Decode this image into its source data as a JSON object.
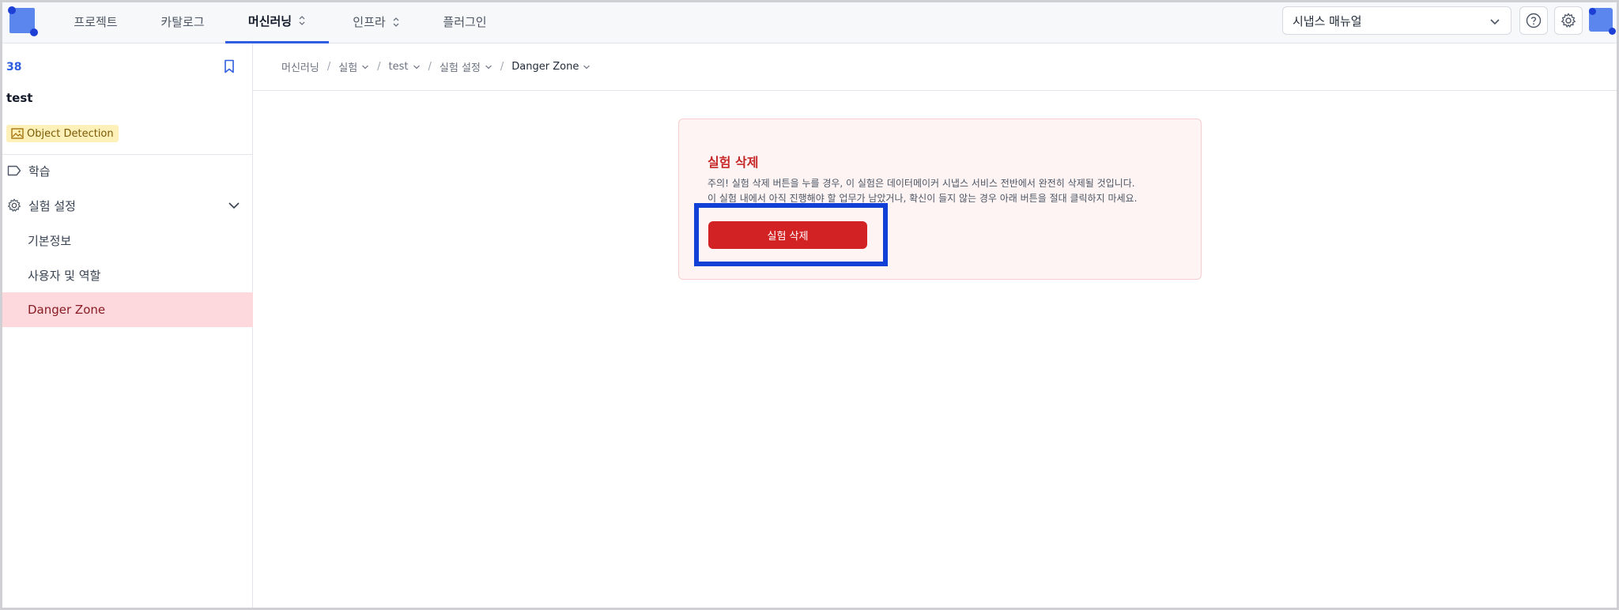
{
  "topnav": {
    "items": [
      {
        "label": "프로젝트"
      },
      {
        "label": "카탈로그"
      },
      {
        "label": "머신러닝"
      },
      {
        "label": "인프라"
      },
      {
        "label": "플러그인"
      }
    ],
    "manual_select": "시냅스 매뉴얼"
  },
  "sidebar": {
    "id": "38",
    "name": "test",
    "tag": "Object Detection",
    "items": [
      {
        "label": "학습"
      },
      {
        "label": "실험 설정"
      },
      {
        "label": "기본정보"
      },
      {
        "label": "사용자 및 역할"
      },
      {
        "label": "Danger Zone"
      }
    ]
  },
  "breadcrumb": [
    "머신러닝",
    "실험",
    "test",
    "실험 설정",
    "Danger Zone"
  ],
  "danger": {
    "title": "실험 삭제",
    "line1": "주의! 실험 삭제 버튼을 누를 경우, 이 실험은 데이터메이커 시냅스 서비스 전반에서 완전히 삭제될 것입니다.",
    "line2": "이 실험 내에서 아직 진행해야 할 업무가 남았거나, 확신이 들지 않는 경우 아래 버튼을 절대 클릭하지 마세요.",
    "button": "실험 삭제"
  },
  "colors": {
    "accent": "#2f5fe0",
    "danger": "#d32224",
    "danger_bg": "#fef4f4",
    "active_sidebar": "#fdd8dc",
    "tag_bg": "#fdf0b8",
    "highlight": "#1140d6"
  }
}
